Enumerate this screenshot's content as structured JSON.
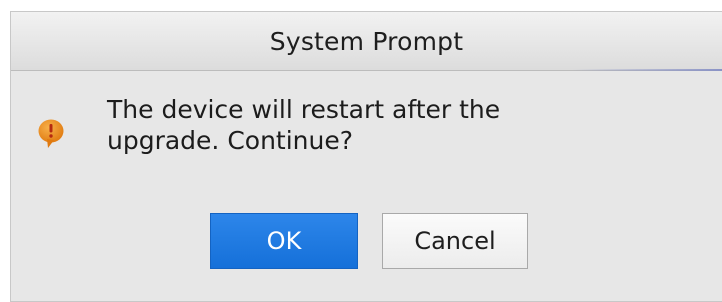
{
  "dialog": {
    "title": "System Prompt",
    "icon": "warning-icon",
    "message_line1": "The device will restart after the",
    "message_line2": "upgrade. Continue?",
    "ok_label": "OK",
    "cancel_label": "Cancel"
  },
  "colors": {
    "icon": "#e8871a",
    "ok_button": "#1d78e0",
    "dialog_background": "#e7e7e7"
  }
}
